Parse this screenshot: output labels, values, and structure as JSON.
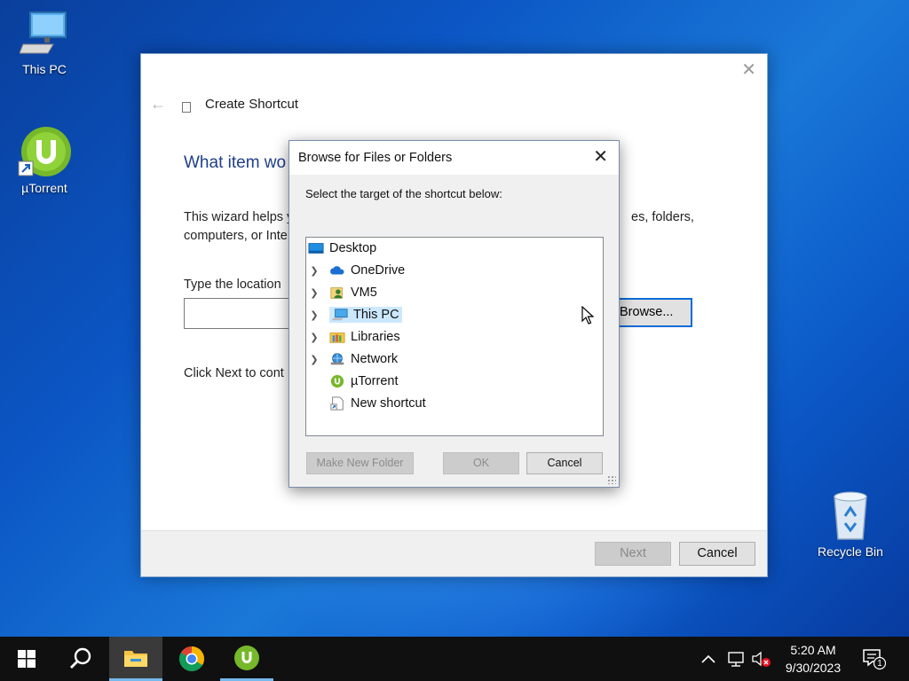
{
  "desktop": {
    "icons": [
      {
        "label": "This PC"
      },
      {
        "label": "µTorrent"
      },
      {
        "label": "Recycle Bin"
      }
    ]
  },
  "wizard": {
    "title": "Create Shortcut",
    "heading": "What item wo",
    "desc_line1_start": "This wizard helps y",
    "desc_line1_end": "es, folders,",
    "desc_line2": "computers, or Inte",
    "location_label": "Type the location",
    "location_value": "",
    "browse_label": "Browse...",
    "click_next": "Click Next to cont",
    "next_label": "Next",
    "cancel_label": "Cancel"
  },
  "browse_dialog": {
    "title": "Browse for Files or Folders",
    "prompt": "Select the target of the shortcut below:",
    "tree": [
      {
        "label": "Desktop",
        "icon": "desktop-folder-icon",
        "expandable": false,
        "selected": false
      },
      {
        "label": "OneDrive",
        "icon": "onedrive-cloud-icon",
        "expandable": true,
        "selected": false
      },
      {
        "label": "VM5",
        "icon": "user-folder-icon",
        "expandable": true,
        "selected": false
      },
      {
        "label": "This PC",
        "icon": "computer-icon",
        "expandable": true,
        "selected": true
      },
      {
        "label": "Libraries",
        "icon": "libraries-folder-icon",
        "expandable": true,
        "selected": false
      },
      {
        "label": "Network",
        "icon": "network-icon",
        "expandable": true,
        "selected": false
      },
      {
        "label": "µTorrent",
        "icon": "utorrent-icon",
        "expandable": false,
        "selected": false
      },
      {
        "label": "New shortcut",
        "icon": "shortcut-file-icon",
        "expandable": false,
        "selected": false
      }
    ],
    "make_folder_label": "Make New Folder",
    "ok_label": "OK",
    "cancel_label": "Cancel"
  },
  "taskbar": {
    "clock_time": "5:20 AM",
    "clock_date": "9/30/2023",
    "notification_count": "1"
  },
  "colors": {
    "accent": "#0b6bd6",
    "heading_blue": "#1e3f8a",
    "selection": "#cce8ff",
    "utorrent_green": "#76b82a"
  }
}
